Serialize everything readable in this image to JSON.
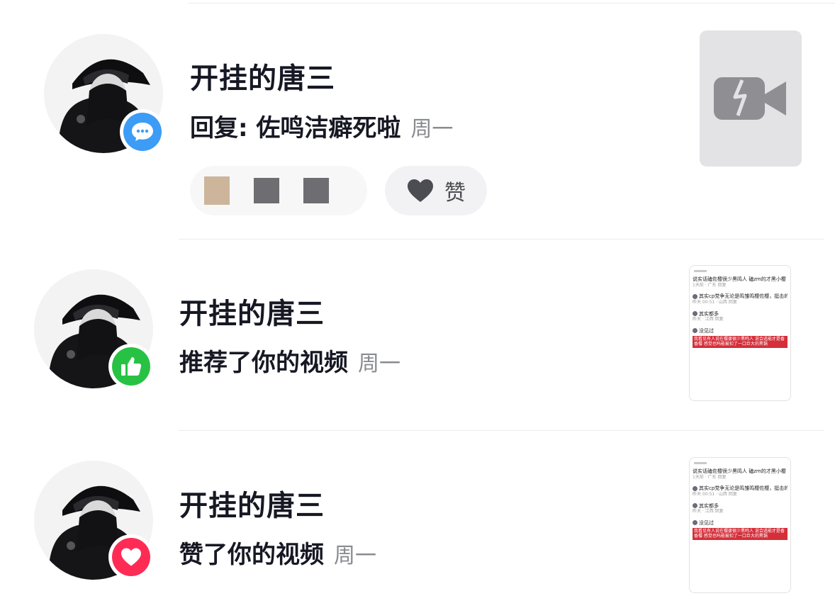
{
  "notifications": [
    {
      "username": "开挂的唐三",
      "action": "回复: 佐鸣洁癖死啦",
      "time": "周一",
      "badge": "comment-icon",
      "badge_color": "#3c9cf6",
      "like_label": "赞"
    },
    {
      "username": "开挂的唐三",
      "action": "推荐了你的视频",
      "time": "周一",
      "badge": "thumbs-up-icon",
      "badge_color": "#27c244"
    },
    {
      "username": "开挂的唐三",
      "action": "赞了你的视频",
      "time": "周一",
      "badge": "heart-icon",
      "badge_color": "#fe2c55"
    }
  ],
  "thumbnail": {
    "title": "说实话磕佐樱很少黑鸣人 磕zm的才黑小樱",
    "meta1": "1天前 · 广东   回复",
    "comment1": "其实cp党争无论是鸣雏鸣樱佐樱，挺击的都是女孩子",
    "meta2": "昨天 00:51 · 山西   回复",
    "comment2": "其实都多",
    "meta3": "昨天 · 江西   回复",
    "comment3": "没见过",
    "highlight": "我看见有人说在樱婆很少黑鸣人 说合适能才是香香樱 感觉也吗能被扣了一口巨大的黑锅"
  }
}
